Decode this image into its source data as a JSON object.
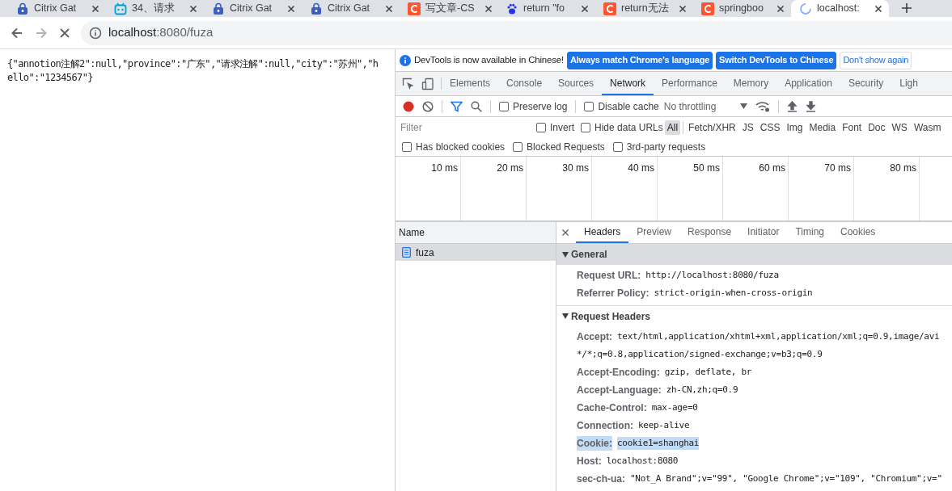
{
  "browser_tabs": [
    {
      "title": "Citrix Gat",
      "kind": "lock",
      "selected": false
    },
    {
      "title": "34、请求",
      "kind": "bot",
      "selected": false
    },
    {
      "title": "Citrix Gat",
      "kind": "lock",
      "selected": false
    },
    {
      "title": "Citrix Gat",
      "kind": "lock",
      "selected": false
    },
    {
      "title": "写文章-CS",
      "kind": "c",
      "selected": false
    },
    {
      "title": "return \"fo",
      "kind": "paw",
      "selected": false
    },
    {
      "title": "return无法",
      "kind": "c",
      "selected": false
    },
    {
      "title": "springboo",
      "kind": "c",
      "selected": false
    },
    {
      "title": "localhost:",
      "kind": "spinner",
      "selected": true
    }
  ],
  "address_bar": {
    "host": "localhost",
    "rest": ":8080/fuza"
  },
  "page": {
    "body": "{\"annotion注解2\":null,\"province\":\"广东\",\"请求注解\":null,\"city\":\"苏州\",\"hello\":\"1234567\"}"
  },
  "devtools": {
    "infobar": {
      "message": "DevTools is now available in Chinese!",
      "buttons": [
        {
          "label": "Always match Chrome's language",
          "kind": "primary"
        },
        {
          "label": "Switch DevTools to Chinese",
          "kind": "primary"
        },
        {
          "label": "Don't show again",
          "kind": "secondary"
        }
      ]
    },
    "panel_tabs": [
      {
        "label": "Elements",
        "selected": false
      },
      {
        "label": "Console",
        "selected": false
      },
      {
        "label": "Sources",
        "selected": false
      },
      {
        "label": "Network",
        "selected": true
      },
      {
        "label": "Performance",
        "selected": false
      },
      {
        "label": "Memory",
        "selected": false
      },
      {
        "label": "Application",
        "selected": false
      },
      {
        "label": "Security",
        "selected": false
      },
      {
        "label": "Ligh",
        "selected": false
      }
    ],
    "toolbar": {
      "recording": true,
      "preserve_log": {
        "label": "Preserve log",
        "checked": false
      },
      "disable_cache": {
        "label": "Disable cache",
        "checked": false
      },
      "throttling": "No throttling"
    },
    "filter": {
      "placeholder": "Filter",
      "invert": {
        "label": "Invert",
        "checked": false
      },
      "hide_data_urls": {
        "label": "Hide data URLs",
        "checked": false
      },
      "types": [
        {
          "label": "All",
          "selected": true
        },
        {
          "label": "Fetch/XHR",
          "selected": false
        },
        {
          "label": "JS",
          "selected": false
        },
        {
          "label": "CSS",
          "selected": false
        },
        {
          "label": "Img",
          "selected": false
        },
        {
          "label": "Media",
          "selected": false
        },
        {
          "label": "Font",
          "selected": false
        },
        {
          "label": "Doc",
          "selected": false
        },
        {
          "label": "WS",
          "selected": false
        },
        {
          "label": "Wasm",
          "selected": false
        }
      ]
    },
    "extra_filters": [
      {
        "label": "Has blocked cookies",
        "checked": false
      },
      {
        "label": "Blocked Requests",
        "checked": false
      },
      {
        "label": "3rd-party requests",
        "checked": false
      }
    ],
    "timeline_ticks": [
      "10 ms",
      "20 ms",
      "30 ms",
      "40 ms",
      "50 ms",
      "60 ms",
      "70 ms",
      "80 ms"
    ],
    "requests": {
      "column": "Name",
      "rows": [
        {
          "name": "fuza",
          "selected": true
        }
      ]
    },
    "detail_tabs": [
      {
        "label": "Headers",
        "selected": true
      },
      {
        "label": "Preview",
        "selected": false
      },
      {
        "label": "Response",
        "selected": false
      },
      {
        "label": "Initiator",
        "selected": false
      },
      {
        "label": "Timing",
        "selected": false
      },
      {
        "label": "Cookies",
        "selected": false
      }
    ],
    "sections": [
      {
        "title": "General",
        "expanded": true,
        "rows": [
          {
            "name": "Request URL:",
            "value_lines": [
              "http://localhost:8080/fuza"
            ],
            "selected": false
          },
          {
            "name": "Referrer Policy:",
            "value_lines": [
              "strict-origin-when-cross-origin"
            ],
            "selected": false
          }
        ]
      },
      {
        "title": "Request Headers",
        "expanded": true,
        "rows": [
          {
            "name": "Accept:",
            "value_lines": [
              "text/html,application/xhtml+xml,application/xml;q=0.9,image/avi",
              "*/*;q=0.8,application/signed-exchange;v=b3;q=0.9"
            ],
            "selected": false
          },
          {
            "name": "Accept-Encoding:",
            "value_lines": [
              "gzip, deflate, br"
            ],
            "selected": false
          },
          {
            "name": "Accept-Language:",
            "value_lines": [
              "zh-CN,zh;q=0.9"
            ],
            "selected": false
          },
          {
            "name": "Cache-Control:",
            "value_lines": [
              "max-age=0"
            ],
            "selected": false
          },
          {
            "name": "Connection:",
            "value_lines": [
              "keep-alive"
            ],
            "selected": false
          },
          {
            "name": "Cookie:",
            "value_lines": [
              "cookie1=shanghai"
            ],
            "selected": true
          },
          {
            "name": "Host:",
            "value_lines": [
              "localhost:8080"
            ],
            "selected": false
          },
          {
            "name": "sec-ch-ua:",
            "value_lines": [
              "\"Not_A Brand\";v=\"99\", \"Google Chrome\";v=\"109\", \"Chromium\";v=\""
            ],
            "selected": false
          }
        ]
      }
    ]
  }
}
